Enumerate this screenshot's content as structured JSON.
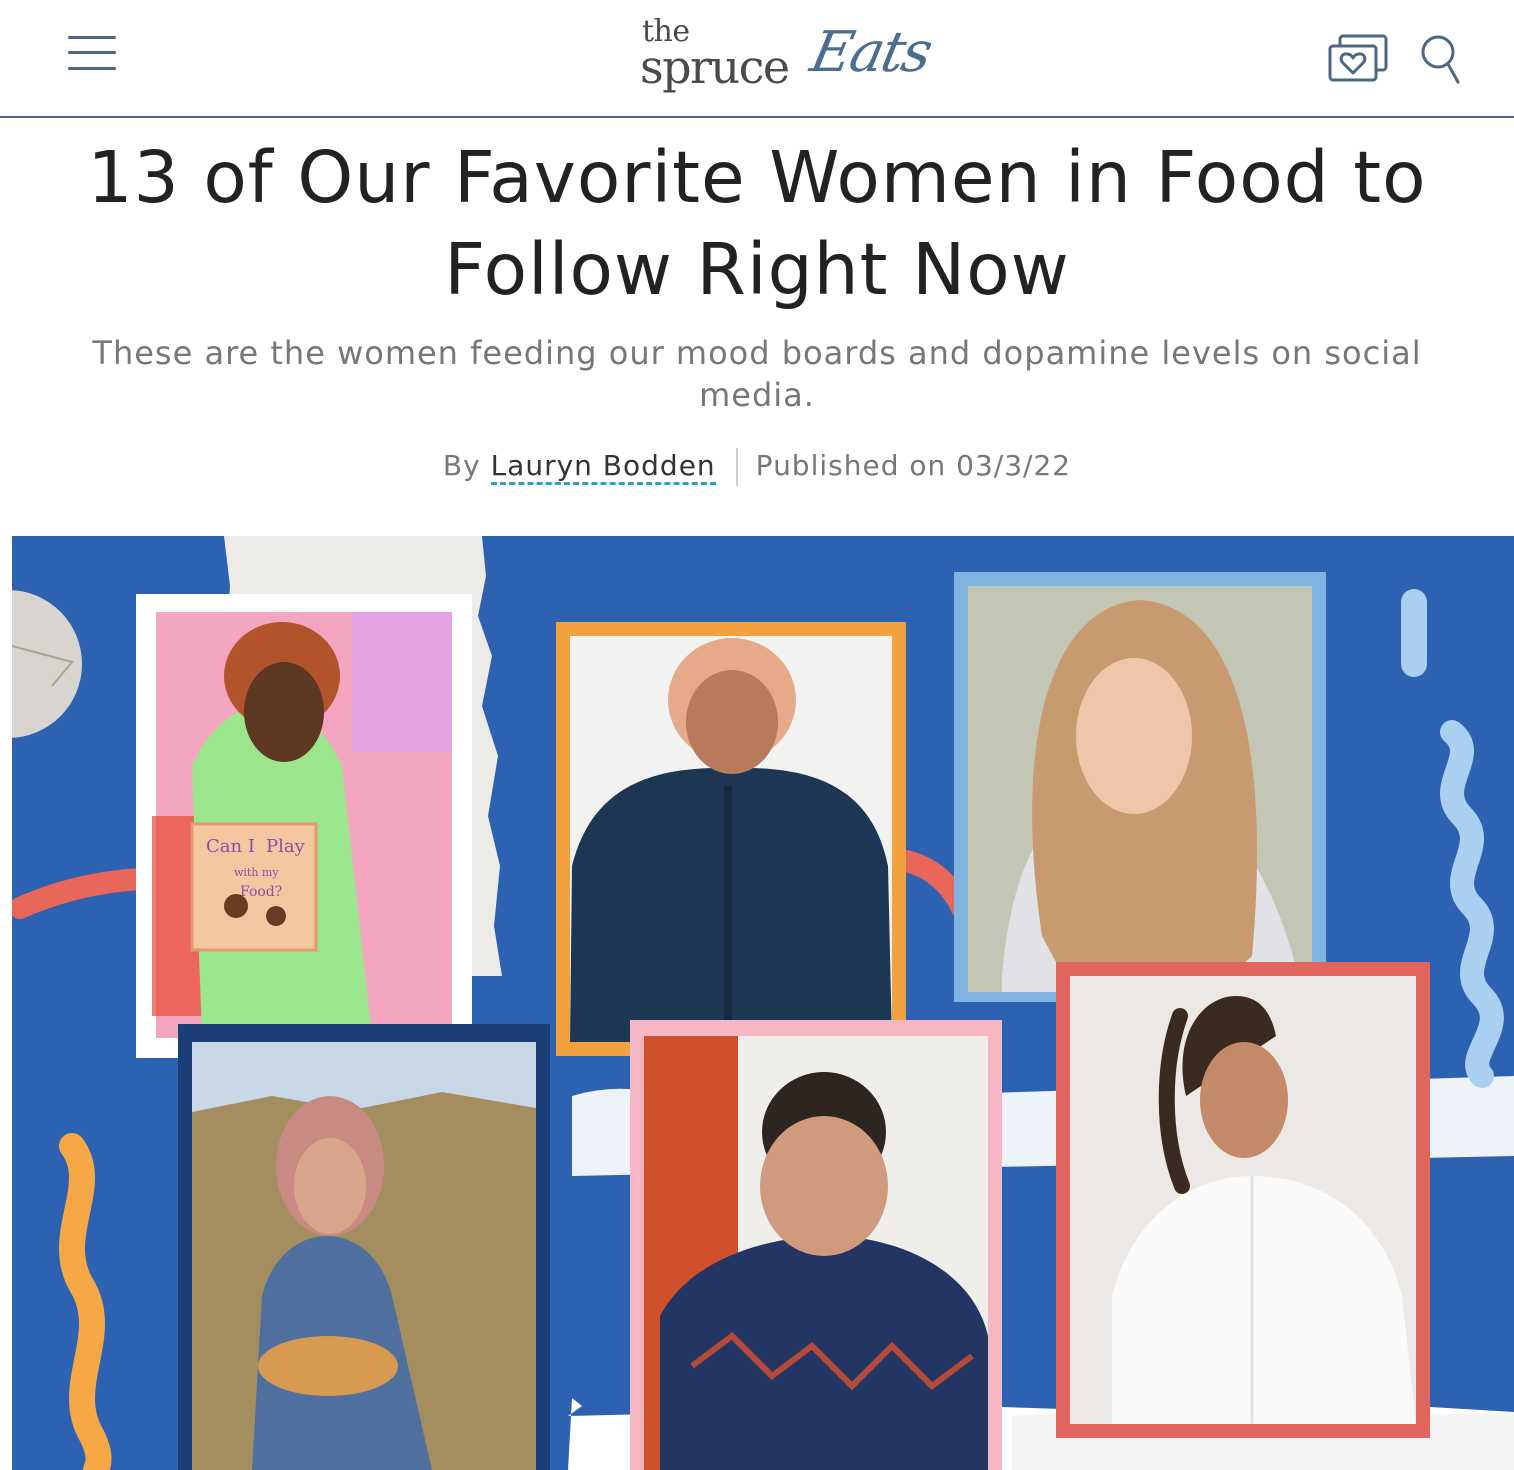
{
  "header": {
    "menu_icon": "hamburger-menu-icon",
    "logo": {
      "the": "the",
      "spruce": "spruce",
      "eats": "Eats"
    },
    "saved_icon": "saved-recipes-heart-icon",
    "search_icon": "search-icon",
    "accent_color": "#4b6784",
    "eats_color": "#4b6d8f"
  },
  "article": {
    "title": "13 of Our Favorite Women in Food to Follow Right Now",
    "dek": "These are the women feeding our mood boards and dopamine levels on social media.",
    "byline": {
      "by": "By",
      "author": "Lauryn Bodden",
      "published": "Published on 03/3/22"
    }
  },
  "hero": {
    "background_color": "#2d62b3",
    "book": {
      "line1": "Can I",
      "line2": "Play",
      "line3": "with my",
      "line4": "Food?"
    },
    "frame_colors": [
      "#ffffff",
      "#f2a13f",
      "#82b4e2",
      "#f7b6c3",
      "#e0655c",
      "#1c3e78"
    ]
  }
}
